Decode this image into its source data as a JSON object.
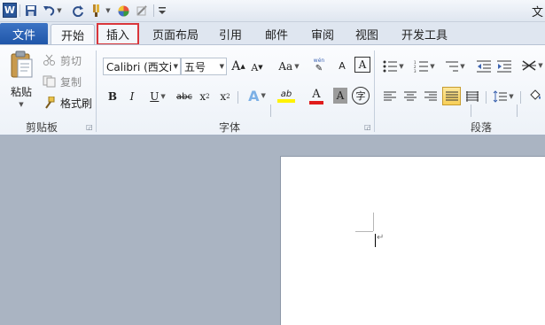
{
  "titlebar": {
    "app_icon_letter": "W",
    "title": "文",
    "qat": {
      "save_icon": "save-icon",
      "undo_icon": "undo-icon",
      "redo_icon": "redo-icon",
      "format_icon": "format-painter-icon",
      "color_icon": "color-wheel-icon",
      "draw_icon": "draw-icon",
      "customize_icon": "customize-qat-icon"
    }
  },
  "tabs": {
    "file": "文件",
    "home": "开始",
    "insert": "插入",
    "page_layout": "页面布局",
    "references": "引用",
    "mailings": "邮件",
    "review": "审阅",
    "view": "视图",
    "developer": "开发工具"
  },
  "highlight_color": "#d9363b",
  "clipboard": {
    "paste": "粘贴",
    "cut": "剪切",
    "copy": "复制",
    "format_painter": "格式刷",
    "group_label": "剪贴板"
  },
  "font": {
    "font_name": "Calibri (西文i",
    "font_size": "五号",
    "grow_font": "A",
    "shrink_font": "A",
    "change_case": "Aa",
    "bold": "B",
    "italic": "I",
    "underline": "U",
    "strikethrough": "abc",
    "subscript": "x",
    "superscript": "x",
    "text_effect": "A",
    "highlight": "ab",
    "font_color": "A",
    "char_shading": "A",
    "enclose_char": "字",
    "char_border": "A",
    "phonetic": "wén",
    "clear_format": "A",
    "group_label": "字体"
  },
  "paragraph": {
    "group_label": "段落"
  },
  "document": {
    "para_mark": "↵"
  }
}
